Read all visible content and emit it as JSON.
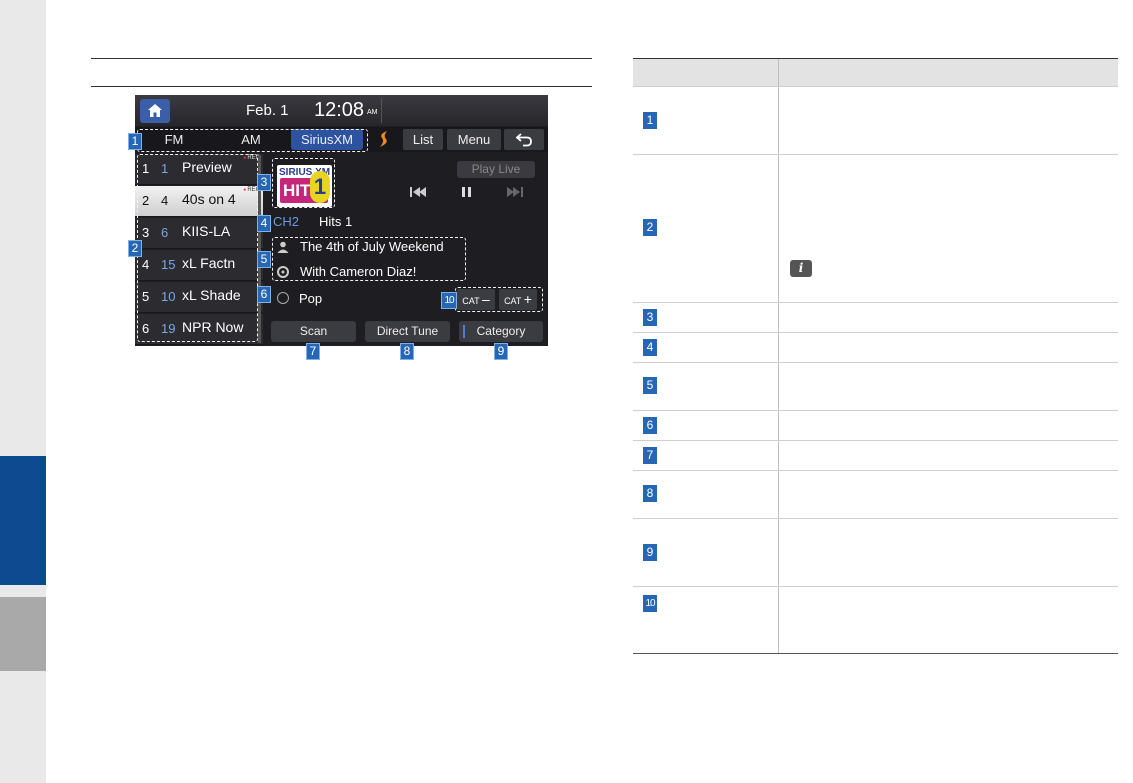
{
  "screen": {
    "date": "Feb.  1",
    "time": "12:08",
    "ampm": "AM",
    "tabs": [
      "FM",
      "AM",
      "SiriusXM"
    ],
    "buttons": {
      "list": "List",
      "menu": "Menu"
    },
    "presets": [
      {
        "num": "1",
        "channel": "1",
        "title": "Preview",
        "rec": "REC"
      },
      {
        "num": "2",
        "channel": "4",
        "title": "40s on 4",
        "rec": "REC",
        "selected": true
      },
      {
        "num": "3",
        "channel": "6",
        "title": "KIIS-LA"
      },
      {
        "num": "4",
        "channel": "15",
        "title": "xL Factn"
      },
      {
        "num": "5",
        "channel": "10",
        "title": "xL Shade"
      },
      {
        "num": "6",
        "channel": "19",
        "title": "NPR Now"
      }
    ],
    "logo": {
      "top": "SIRIUS XM",
      "hits": "HITS",
      "one": "1"
    },
    "play_live": "Play Live",
    "channel_number": "CH2",
    "channel_name": "Hits 1",
    "song_title": "The 4th of July Weekend",
    "artist": "With Cameron Diaz!",
    "category": "Pop",
    "cat_label": "CAT",
    "bottom_buttons": {
      "scan": "Scan",
      "direct_tune": "Direct Tune",
      "category": "Category"
    }
  },
  "callouts": [
    "1",
    "2",
    "3",
    "4",
    "5",
    "6",
    "7",
    "8",
    "9",
    "10"
  ],
  "table": {
    "rows": [
      "1",
      "2",
      "3",
      "4",
      "5",
      "6",
      "7",
      "8",
      "9",
      "10"
    ]
  },
  "colors": {
    "accent": "#2566b5",
    "side_tab": "#0d4a8f"
  }
}
